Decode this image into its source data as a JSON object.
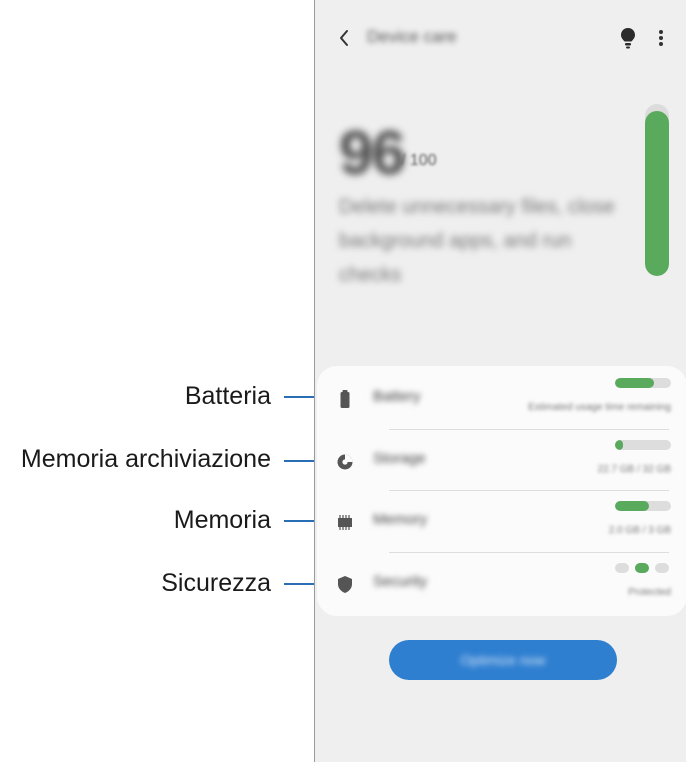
{
  "appbar": {
    "title": "Device care",
    "icons": [
      "back-icon",
      "lightbulb-icon",
      "more-options-icon"
    ]
  },
  "score": {
    "value": "96",
    "max": "/ 100",
    "description": "Delete unnecessary files, close background apps, and run checks",
    "gauge_level": 0.96
  },
  "card_rows": [
    {
      "label": "Battery",
      "detail": "Estimated usage time remaining",
      "level": 0.7,
      "icon": "battery-icon"
    },
    {
      "label": "Storage",
      "detail": "22.7 GB / 32 GB",
      "level": 0.15,
      "icon": "storage-pie-icon"
    },
    {
      "label": "Memory",
      "detail": "2.0 GB / 3 GB",
      "level": 0.6,
      "icon": "memory-chip-icon"
    },
    {
      "label": "Security",
      "detail": "Protected",
      "icon": "shield-icon"
    }
  ],
  "action_button": {
    "label": "Optimize now"
  },
  "callouts": [
    {
      "label": "Batteria"
    },
    {
      "label": "Memoria archiviazione"
    },
    {
      "label": "Memoria"
    },
    {
      "label": "Sicurezza"
    }
  ],
  "colors": {
    "accent_green": "#5aaa5e",
    "button_blue": "#2f7fd1",
    "callout_line": "#2a6fb5",
    "screen_bg": "#efefef"
  }
}
